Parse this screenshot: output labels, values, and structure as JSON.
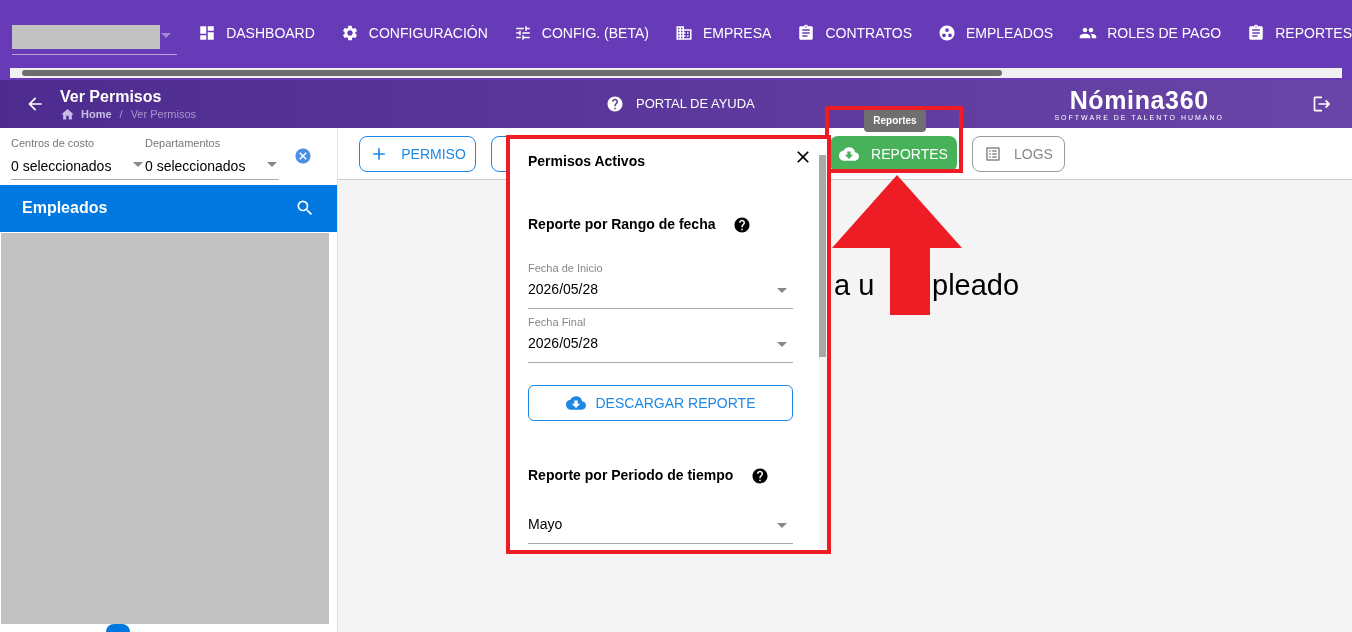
{
  "nav": [
    {
      "label": "DASHBOARD"
    },
    {
      "label": "CONFIGURACIÓN"
    },
    {
      "label": "CONFIG. (BETA)"
    },
    {
      "label": "EMPRESA"
    },
    {
      "label": "CONTRATOS"
    },
    {
      "label": "EMPLEADOS"
    },
    {
      "label": "ROLES DE PAGO"
    },
    {
      "label": "REPORTES"
    }
  ],
  "header": {
    "title": "Ver Permisos",
    "breadcrumb": [
      "Home",
      "Ver Permisos"
    ],
    "breadcrumb_separator": "/",
    "help": "PORTAL DE AYUDA",
    "logo": "Nómina360",
    "tagline": "SOFTWARE DE TALENTO HUMANO"
  },
  "filters": [
    {
      "label": "Centros de costo",
      "value": "0 seleccionados"
    },
    {
      "label": "Departamentos",
      "value": "0 seleccionados"
    }
  ],
  "employees": {
    "title": "Empleados"
  },
  "toolbar": [
    {
      "label": "PERMISO",
      "kind": "add"
    },
    {
      "kind": "hidden"
    },
    {
      "label": "REPORTES",
      "kind": "reports"
    },
    {
      "label": "LOGS",
      "kind": "logs"
    }
  ],
  "tooltip": "Reportes",
  "main_text": [
    "a u",
    "pleado"
  ],
  "popup": {
    "title": "Permisos Activos",
    "sections": [
      {
        "title": "Reporte por Rango de fecha",
        "fields": [
          {
            "label": "Fecha de Inicio",
            "value": "2026/05/28"
          },
          {
            "label": "Fecha Final",
            "value": "2026/05/28"
          }
        ],
        "button": "DESCARGAR REPORTE"
      },
      {
        "title": "Reporte por Periodo de tiempo",
        "fields": [
          {
            "value": "Mayo"
          }
        ]
      }
    ]
  }
}
